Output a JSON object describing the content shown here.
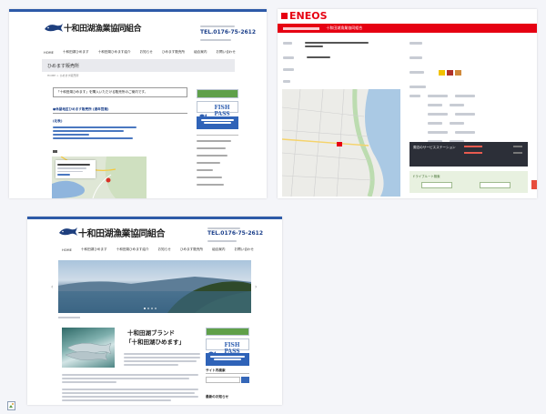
{
  "s1": {
    "tel": "TEL.0176-75-2612",
    "nav": [
      "HOME",
      "十和田湖ひめます",
      "十和田湖ひめます紹介",
      "お知らせ",
      "ひめます販売所",
      "組合案内",
      "お問い合わせ"
    ],
    "page_title": "ひめます販売所",
    "breadcrumb": "HOME > ひめます販売所",
    "intro": "「十和田湖ひめます」を購入いただける販売所のご案内です。",
    "shop_heading": "●休屋地区ひめます販売所 (通年営業)",
    "shop_name": "(北秋)",
    "fishpass": "FISH PASS"
  },
  "s2": {
    "brand": "ENEOS",
    "header_text": "十和田湖漁業協同組合",
    "panel_title": "周辺のサービスステーション",
    "panel_bottom": "ドライブルート検索"
  },
  "s3": {
    "tel": "TEL.0176-75-2612",
    "nav": [
      "HOME",
      "十和田湖ひめます",
      "十和田湖ひめます紹介",
      "お知らせ",
      "ひめます販売所",
      "組合案内",
      "お問い合わせ"
    ],
    "headline_1": "十和田湖ブランド",
    "headline_2": "「十和田湖ひめます」",
    "fishpass": "FISH PASS",
    "side_heading": "サイト内検索",
    "side_heading_2": "最新のお知らせ"
  },
  "colors": {
    "accent_blue": "#2d5aa8",
    "eneos_red": "#e60012",
    "banner_green": "#5fa04a"
  }
}
